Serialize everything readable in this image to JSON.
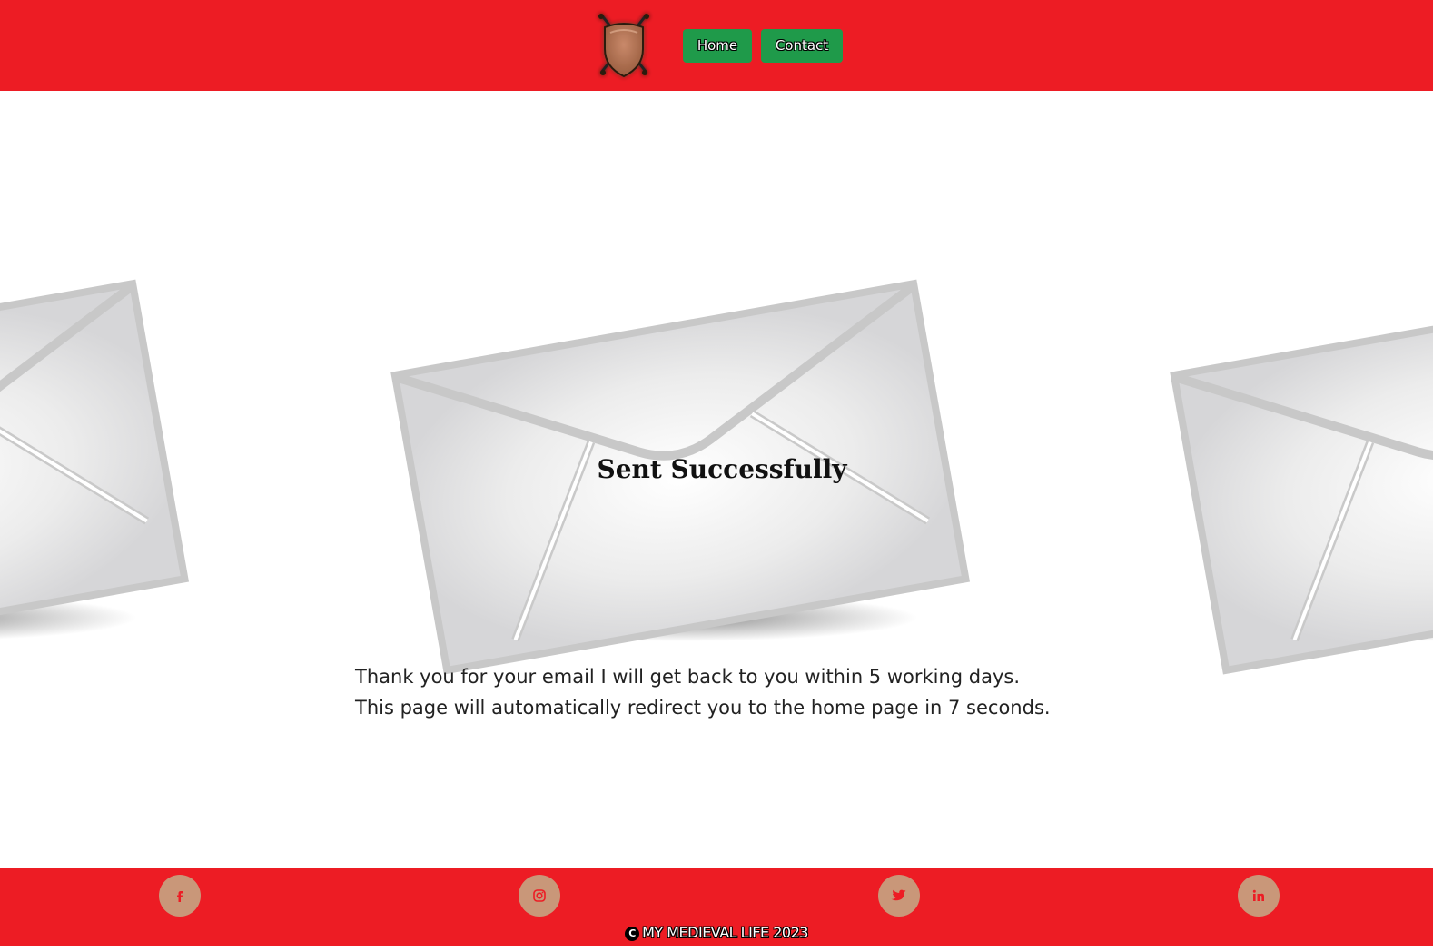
{
  "header": {
    "logo_icon": "shield-crossed-swords-icon",
    "nav": {
      "home_label": "Home",
      "contact_label": "Contact"
    }
  },
  "main": {
    "envelope_title": "Sent Successfully",
    "message_line_1": "Thank you for your email I will get back to you within 5 working days.",
    "message_line_2": "This page will automatically redirect you to the home page in 7 seconds."
  },
  "footer": {
    "social": [
      {
        "name": "facebook",
        "icon": "facebook-icon",
        "glyph": "f"
      },
      {
        "name": "instagram",
        "icon": "instagram-icon",
        "glyph": ""
      },
      {
        "name": "twitter",
        "icon": "twitter-icon",
        "glyph": ""
      },
      {
        "name": "linkedin",
        "icon": "linkedin-icon",
        "glyph": "in"
      }
    ],
    "copyright_symbol": "C",
    "copyright_text": "MY MEDIEVAL LIFE 2023"
  },
  "colors": {
    "header_bg": "#ed1c24",
    "nav_button_bg": "#1f9a4a",
    "social_circle_bg": "#c99779",
    "social_icon_color": "#ed1c24"
  }
}
